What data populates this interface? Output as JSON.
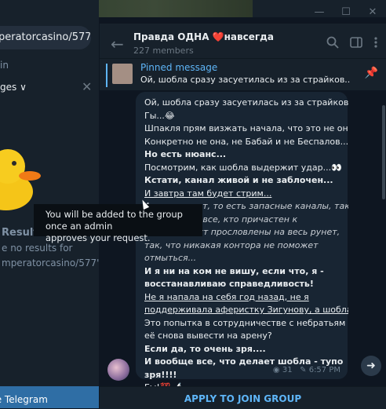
{
  "window": {
    "minimize": "—",
    "maximize": "☐",
    "close": "✕"
  },
  "left_panel": {
    "search_value": "peratоrcаsinо/577",
    "in_label": "in",
    "filter_label": "ges",
    "filter_chevron": "∨",
    "results_title": "Results",
    "no_results_line1": "e no results for",
    "no_results_line2": "mperatorcasino/577\".",
    "update_button": "te Telegram"
  },
  "header": {
    "title": "Правда ОДНА ❤️навсегда",
    "members": "227 members"
  },
  "pinned": {
    "title": "Pinned message",
    "text": "Ой, шобла сразу засуетилась из за страйков... Г..."
  },
  "message": {
    "lines": [
      {
        "text": "Ой, шобла сразу засуетилась из за страйков...",
        "style": ""
      },
      {
        "text": "Гы...😂",
        "style": ""
      },
      {
        "text": "Шпакля прям визжать начала, что это не они...",
        "style": ""
      },
      {
        "text": "Конкретно не она, не Бабай и не Беспалов....",
        "style": ""
      },
      {
        "text": "Но есть нюанс...",
        "style": "b"
      },
      {
        "text": "Посмотрим, как шобла выдержит удар...👀",
        "style": ""
      },
      {
        "text": "Кстати, канал живой и не заблочен...",
        "style": "b"
      },
      {
        "text": "И завтра там будет стрим...",
        "style": "u"
      },
      {
        "text": "А если снесут, то есть запасные каналы, так",
        "style": "i"
      },
      {
        "text": "что, клава и все, кто причастен к",
        "style": "i"
      },
      {
        "text": "травле, будут прословлены на весь рунет,",
        "style": "i"
      },
      {
        "text": "так, что никакая контора не поможет",
        "style": "i"
      },
      {
        "text": "отмыться...",
        "style": "i"
      },
      {
        "text": "И я ни на ком не вишу, если что, я -",
        "style": "b"
      },
      {
        "text": "восстанавливаю справедливость!",
        "style": "b"
      },
      {
        "text": "Не я напала на себя год назад, не я",
        "style": "u"
      },
      {
        "text": "поддерживала аферистку Зигунову, а шобла...",
        "style": "u"
      },
      {
        "text": "Это попытка в сотрудничестве с небратьям и",
        "style": ""
      },
      {
        "text": "её снова вывести на арену?",
        "style": ""
      },
      {
        "text": "Если да, то очень зря....",
        "style": "b"
      },
      {
        "text": "И вообще все, что делает шобла - тупо",
        "style": "b"
      },
      {
        "text": "зря!!!!",
        "style": "b"
      },
      {
        "text": "Гы!💯 🔬",
        "style": ""
      }
    ],
    "views": "31",
    "time": "6:57 PM",
    "views_icon": "eye-icon",
    "pin_icon": "pin-icon"
  },
  "join": {
    "label": "APPLY TO JOIN GROUP"
  },
  "tooltip": {
    "line1": "You will be added to the group once an admin",
    "line2": "approves your request."
  },
  "colors": {
    "accent": "#5eb5f7",
    "panel": "#17212b",
    "background": "#0e1621",
    "bubble": "#182533",
    "update_button": "#2f6ea5"
  }
}
